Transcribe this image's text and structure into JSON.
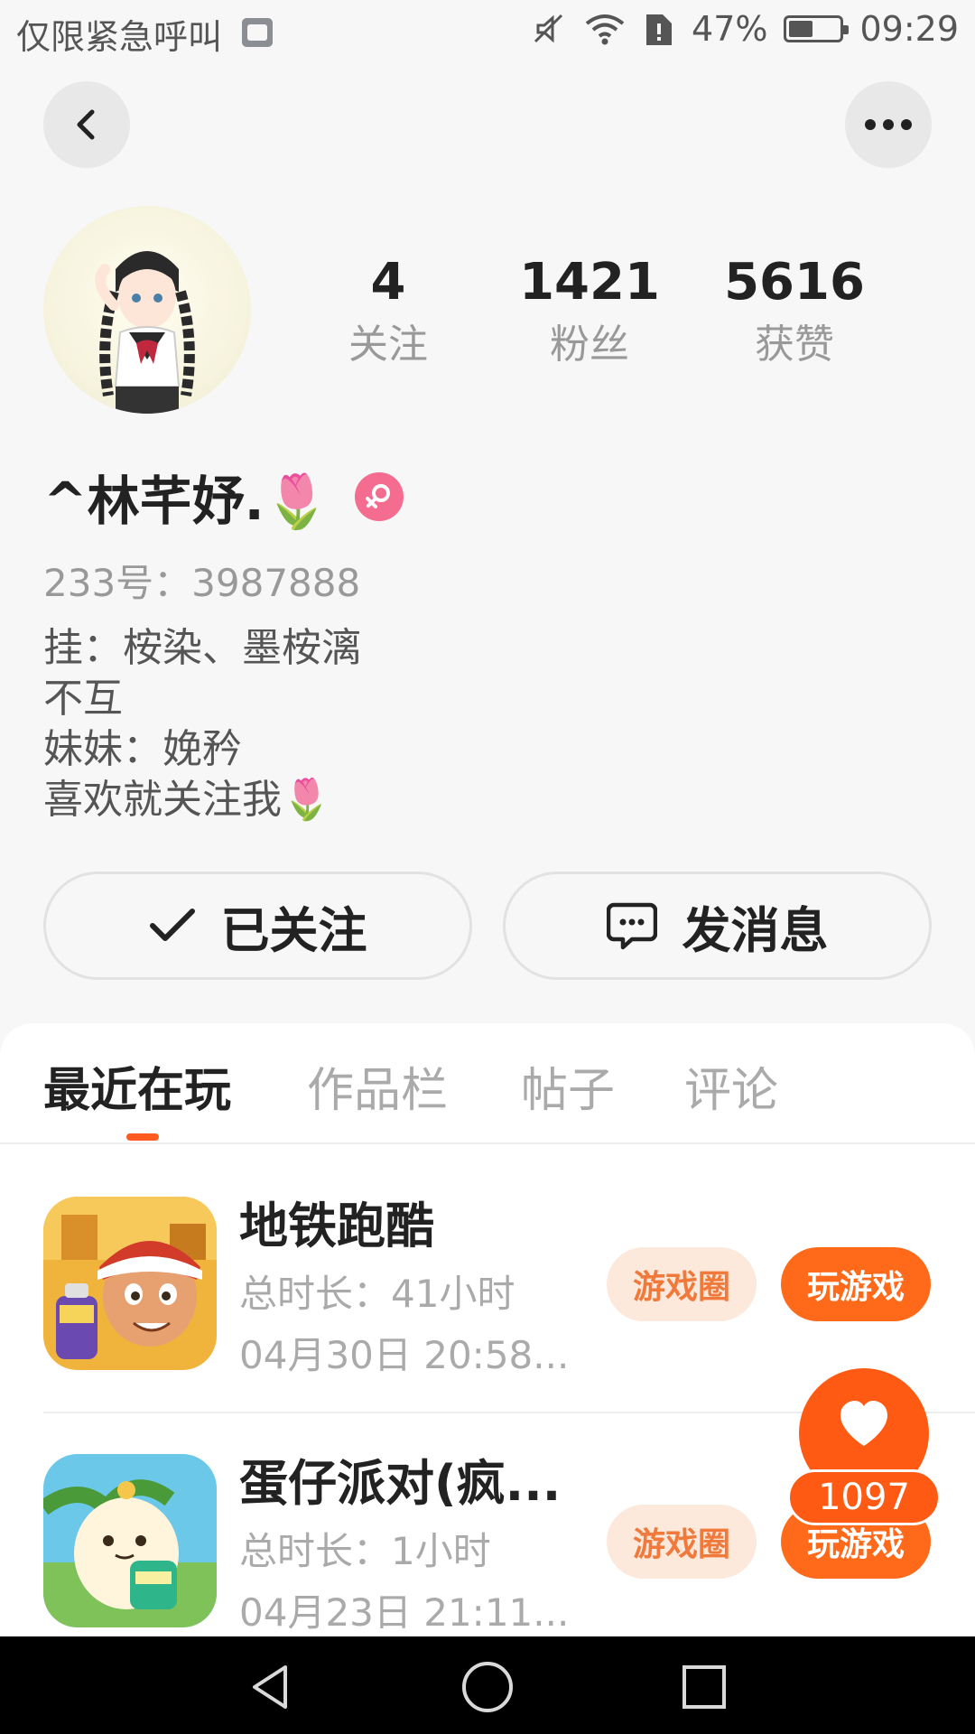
{
  "status_bar": {
    "carrier_text": "仅限紧急呼叫",
    "battery": "47%",
    "time": "09:29"
  },
  "profile": {
    "stats": [
      {
        "value": "4",
        "label": "关注"
      },
      {
        "value": "1421",
        "label": "粉丝"
      },
      {
        "value": "5616",
        "label": "获赞"
      }
    ],
    "name": "^林芊妤.🌷",
    "id_text": "233号：3987888",
    "bio_lines": [
      "挂：桉染、墨桉漓",
      "不互",
      "妹妹：娩矜",
      "喜欢就关注我🌷"
    ]
  },
  "actions": {
    "follow_label": "已关注",
    "message_label": "发消息"
  },
  "tabs": [
    {
      "label": "最近在玩"
    },
    {
      "label": "作品栏"
    },
    {
      "label": "帖子"
    },
    {
      "label": "评论"
    }
  ],
  "games": [
    {
      "title": "地铁跑酷",
      "duration": "总时长：41小时",
      "date": "04月30日 20:58...",
      "circle_label": "游戏圈",
      "play_label": "玩游戏"
    },
    {
      "title": "蛋仔派对(疯...",
      "duration": "总时长：1小时",
      "date": "04月23日 21:11...",
      "circle_label": "游戏圈",
      "play_label": "玩游戏"
    }
  ],
  "like_widget": {
    "count": "1097"
  },
  "colors": {
    "accent": "#ff5a14",
    "pill_bg": "#fde8dc",
    "pill_text": "#f07a3c",
    "gender_female": "#f46c8f"
  },
  "icons": {
    "back": "chevron-left-icon",
    "more": "more-dots-icon",
    "follow": "checkmark-icon",
    "message": "chat-bubble-icon",
    "like": "heart-icon",
    "gender": "female-icon"
  }
}
